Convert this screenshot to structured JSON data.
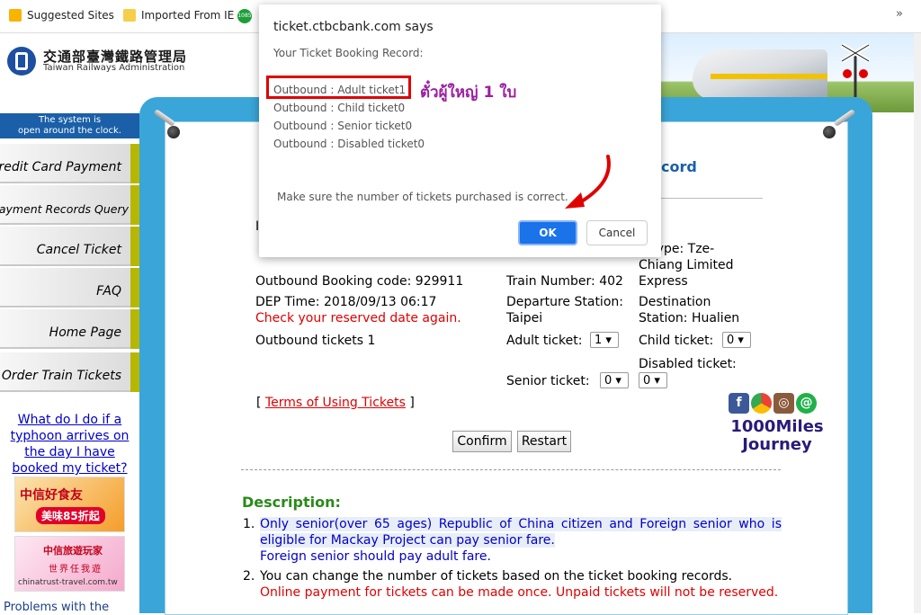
{
  "bookmarks": {
    "items": [
      {
        "label": "Suggested Sites",
        "icon": "bing-icon"
      },
      {
        "label": "Imported From IE",
        "icon": "folder-icon"
      }
    ],
    "badge": "1085",
    "overflow": "»"
  },
  "header": {
    "org_name_zh": "交通部臺灣鐵路管理局",
    "org_name_en": "Taiwan Railways Administration"
  },
  "sidebar": {
    "open_note_line1": "The system is",
    "open_note_line2": "open around the clock.",
    "items": [
      {
        "label": "Credit Card Payment"
      },
      {
        "label": "Payment Records Query"
      },
      {
        "label": "Cancel Ticket"
      },
      {
        "label": "FAQ"
      },
      {
        "label": "Home Page"
      },
      {
        "label": "Order Train Tickets"
      }
    ],
    "typhoon_link": "What do I do if a typhoon arrives on the day I have booked my ticket?",
    "banner_food_text": "中信好食友",
    "banner_food_discount": "美味85折起",
    "banner_travel_text": "中信旅遊玩家",
    "banner_travel_sub": "世界任我遊",
    "banner_travel_url": "chinatrust-travel.com.tw",
    "problems_text": "Problems with the"
  },
  "main": {
    "record_title_partial": "cord",
    "stray_char": "I",
    "train_type": "n Type: Tze-Chiang Limited Express",
    "booking_code": "Outbound Booking code: 929911",
    "train_number": "Train Number: 402",
    "dep_time": "DEP Time: 2018/09/13 06:17",
    "departure_station": "Departure Station: Taipei",
    "destination_station": "Destination Station: Hualien",
    "check_date": "Check your reserved date again.",
    "outbound_tickets": "Outbound tickets 1",
    "adult_label": "Adult ticket:",
    "adult_value": "1",
    "child_label": "Child ticket:",
    "child_value": "0",
    "senior_label": "Senior ticket:",
    "senior_value": "0",
    "disabled_label": "Disabled ticket:",
    "disabled_value": "0",
    "terms_link": "Terms of Using Tickets",
    "confirm_label": "Confirm",
    "restart_label": "Restart",
    "journey_line1": "1000Miles",
    "journey_line2": "Journey",
    "desc_title": "Description:",
    "desc1_line1": "Only senior(over 65 ages) Republic of China citizen and Foreign senior who is eligible for Mackay Project can pay senior fare.",
    "desc1_line2": "Foreign senior should pay adult fare.",
    "desc2_line1": "You can change the number of tickets based on the ticket booking records.",
    "desc2_line2": "Online payment for tickets can be made once. Unpaid tickets will not be reserved."
  },
  "dialog": {
    "title": "ticket.ctbcbank.com says",
    "message": "Your Ticket Booking Record:",
    "lines": [
      "Outbound : Adult ticket1",
      "Outbound : Child ticket0",
      "Outbound : Senior ticket0",
      "Outbound : Disabled ticket0"
    ],
    "footer": "Make sure the number of tickets purchased is correct.",
    "ok_label": "OK",
    "cancel_label": "Cancel",
    "annotation": "ตั๋วผู้ใหญ่ 1 ใบ"
  },
  "colors": {
    "frame_blue": "#3aa5d8",
    "accent_red": "#e00000",
    "ok_blue": "#1a73e8",
    "annotation_purple": "#9b1fa0"
  }
}
